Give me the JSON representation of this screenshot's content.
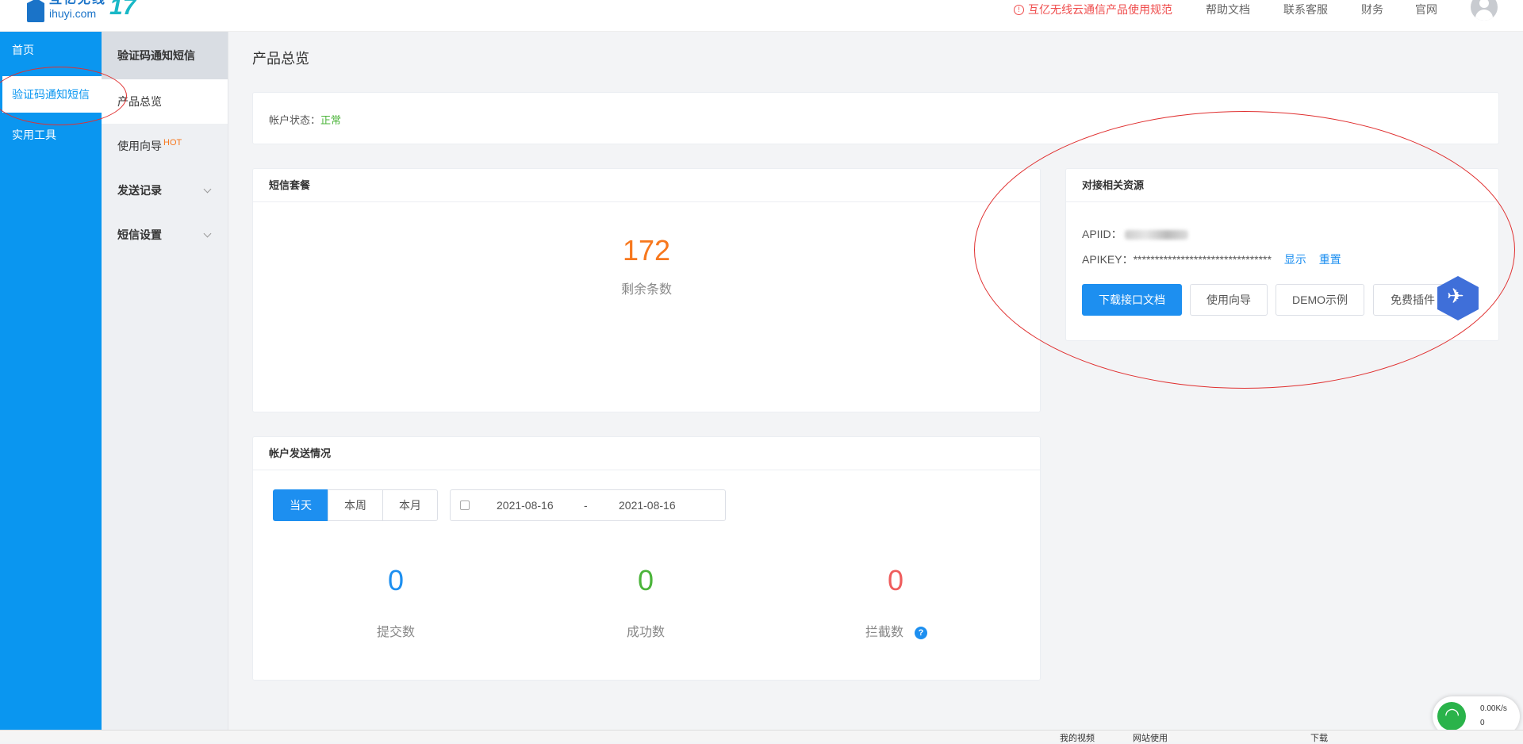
{
  "header": {
    "logo_cn": "互亿无线",
    "logo_en": "ihuyi.com",
    "logo_number": "17",
    "notice": "互亿无线云通信产品使用规范",
    "links": [
      "帮助文档",
      "联系客服",
      "财务",
      "官网"
    ]
  },
  "sidebar": {
    "items": [
      "首页",
      "验证码通知短信",
      "实用工具"
    ]
  },
  "submenu": {
    "title": "验证码通知短信",
    "items": [
      {
        "label": "产品总览"
      },
      {
        "label": "使用向导",
        "badge": "HOT"
      },
      {
        "label": "发送记录"
      },
      {
        "label": "短信设置"
      }
    ]
  },
  "page": {
    "title": "产品总览"
  },
  "account": {
    "status_label": "帐户状态：",
    "status_value": "正常"
  },
  "package": {
    "title": "短信套餐",
    "remaining": "172",
    "remaining_label": "剩余条数"
  },
  "resources": {
    "title": "对接相关资源",
    "apiid_label": "APIID：",
    "apikey_label": "APIKEY：",
    "apikey_masked": "********************************",
    "show_link": "显示",
    "reset_link": "重置",
    "buttons": [
      "下载接口文档",
      "使用向导",
      "DEMO示例",
      "免费插件"
    ]
  },
  "sending": {
    "title": "帐户发送情况",
    "ranges": [
      "当天",
      "本周",
      "本月"
    ],
    "date_from": "2021-08-16",
    "date_sep": "-",
    "date_to": "2021-08-16",
    "stats": [
      {
        "value": "0",
        "label": "提交数",
        "color": "#1d8ff0"
      },
      {
        "value": "0",
        "label": "成功数",
        "color": "#4bb43a"
      },
      {
        "value": "0",
        "label": "拦截数",
        "color": "#ef5d5d"
      }
    ],
    "help_icon": "?"
  },
  "network": {
    "speed": "0.00K/s",
    "count": "0"
  },
  "taskbar": {
    "items": [
      "我的视频",
      "网站使用",
      "下载"
    ]
  },
  "colors": {
    "sidebar": "#0a96f0",
    "primary": "#1d8ff0",
    "remaining": "#f7781e",
    "annotation": "#e03030"
  }
}
